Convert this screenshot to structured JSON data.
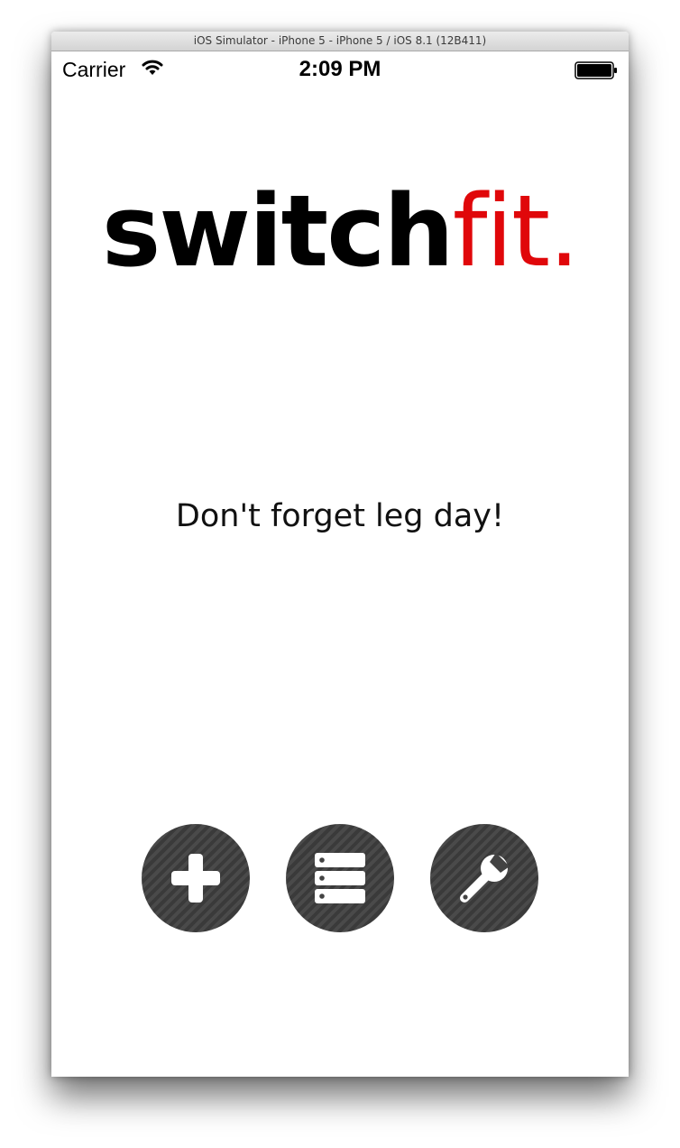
{
  "window": {
    "title": "iOS Simulator - iPhone 5 - iPhone 5 / iOS 8.1 (12B411)"
  },
  "statusbar": {
    "carrier": "Carrier",
    "time": "2:09 PM",
    "wifi_icon": "wifi-icon",
    "battery_icon": "battery-icon"
  },
  "logo": {
    "part1": "switch",
    "part2": "fit.",
    "part1_color": "#000000",
    "part2_color": "#e0070a"
  },
  "tagline": "Don't forget leg day!",
  "buttons": [
    {
      "icon": "plus-icon"
    },
    {
      "icon": "list-icon"
    },
    {
      "icon": "wrench-icon"
    }
  ],
  "colors": {
    "button_bg": "#434343",
    "accent": "#e0070a"
  }
}
